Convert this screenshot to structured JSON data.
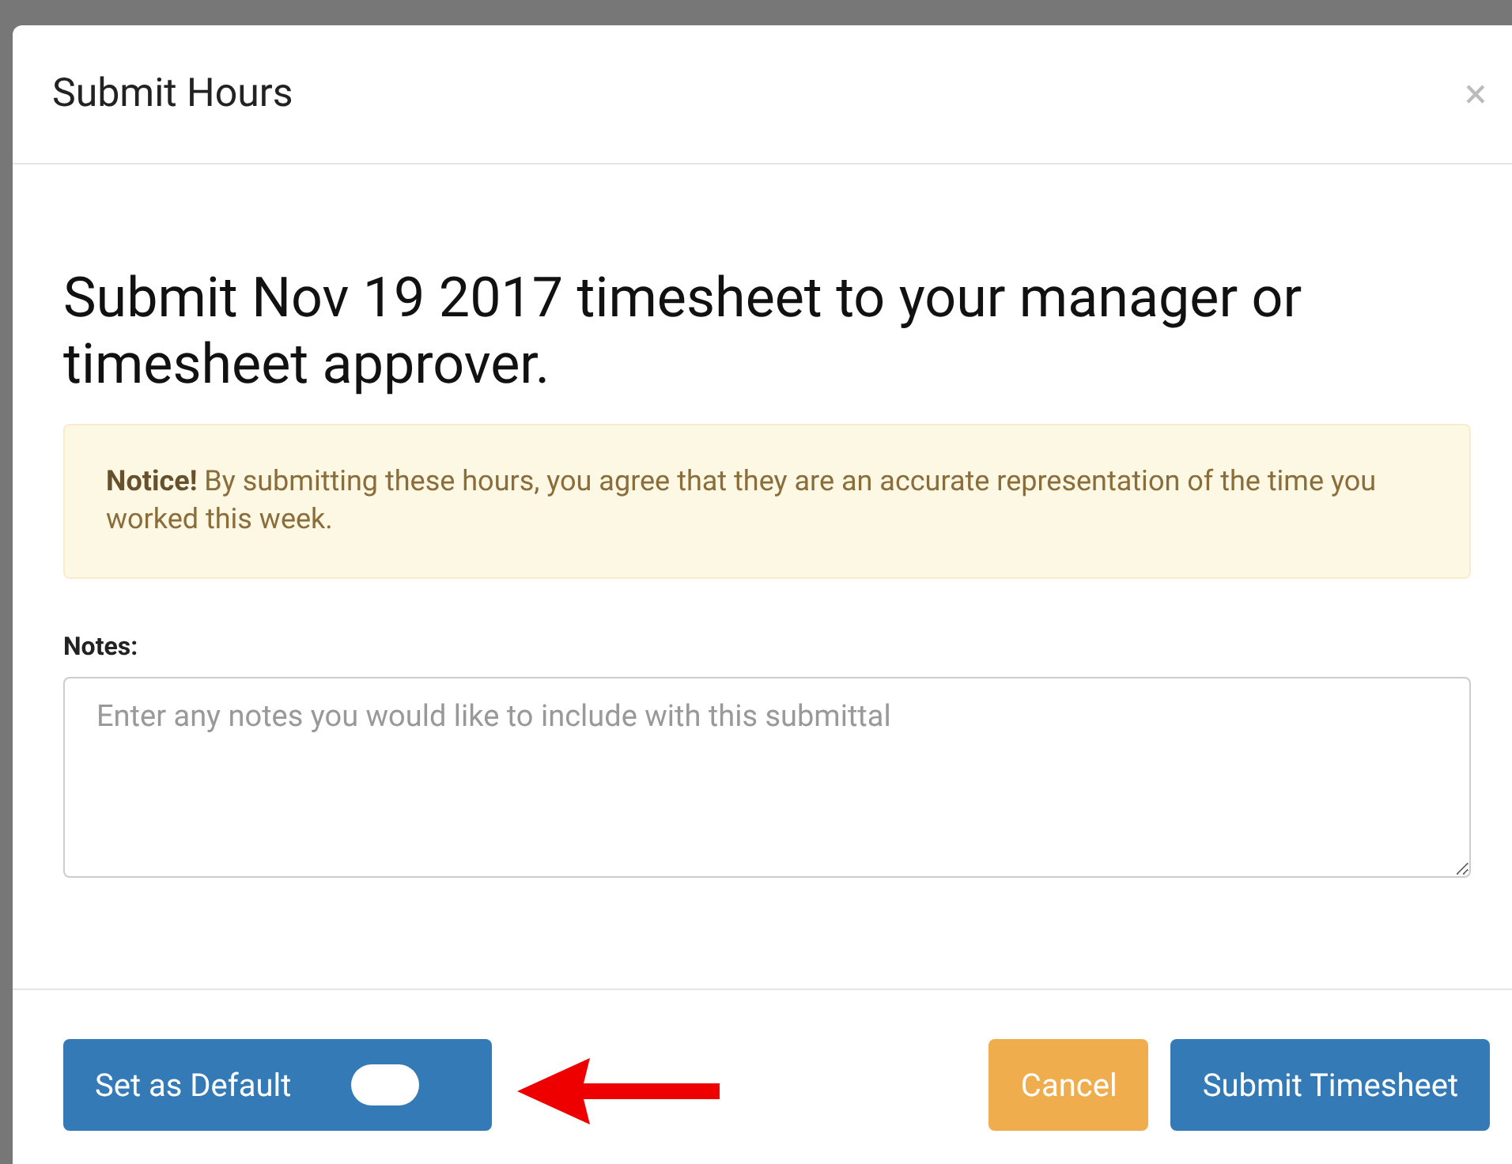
{
  "modal": {
    "title": "Submit Hours",
    "close": "×"
  },
  "heading": "Submit Nov 19 2017 timesheet to your manager or timesheet approver.",
  "notice": "**Notice!** By submitting these hours, you agree that they are an accurate representation of the time you worked this week.",
  "notes": {
    "label": "Notes:",
    "placeholder": "Enter any notes you would like to include with this submittal"
  },
  "footer": {
    "default_button": {
      "label": "Set as Default",
      "on": false
    },
    "buttons": [
      {
        "label": "Cancel",
        "kind": "warning"
      },
      {
        "label": "Submit Timesheet",
        "kind": "primary"
      }
    ]
  }
}
